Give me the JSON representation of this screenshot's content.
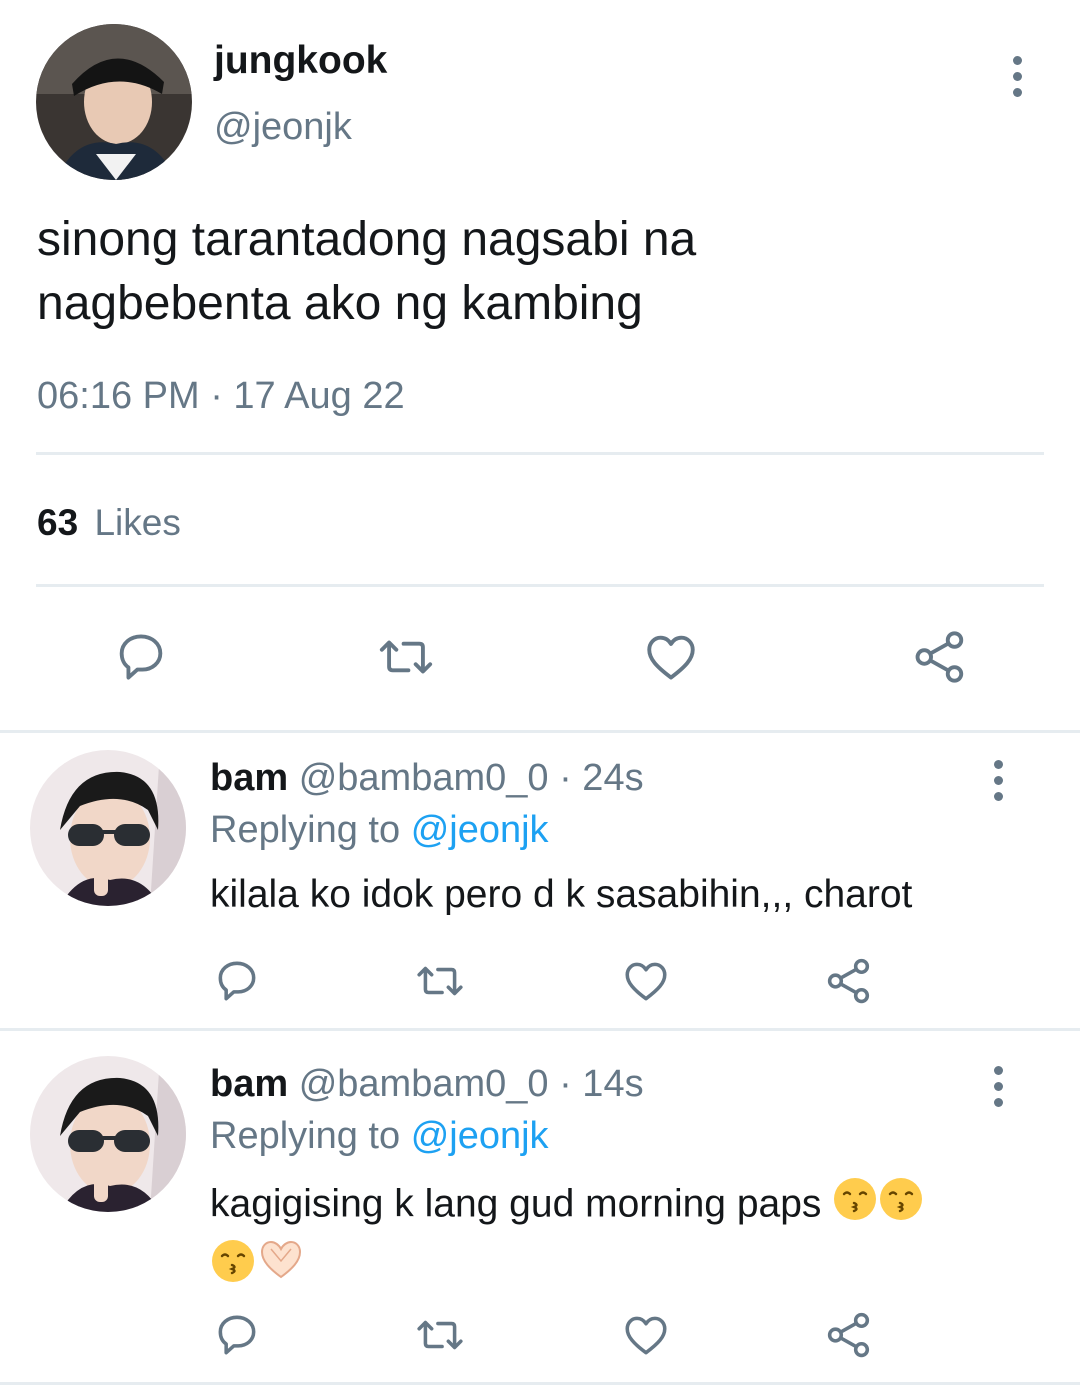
{
  "main_tweet": {
    "display_name": "jungkook",
    "handle": "@jeonjk",
    "text_line1": "sinong tarantadong nagsabi na",
    "text_line2": "nagbebenta ako ng kambing",
    "timestamp": "06:16 PM · 17 Aug 22",
    "likes_count": "63",
    "likes_label": "Likes",
    "actions": [
      "reply-icon",
      "retweet-icon",
      "like-icon",
      "share-icon"
    ]
  },
  "replies": [
    {
      "display_name": "bam",
      "handle": "@bambam0_0",
      "time": "· 24s",
      "replying_prefix": "Replying to",
      "replying_handle": "@jeonjk",
      "text": "kilala ko idok pero d k sasabihin,,, charot"
    },
    {
      "display_name": "bam",
      "handle": "@bambam0_0",
      "time": "· 14s",
      "replying_prefix": "Replying to",
      "replying_handle": "@jeonjk",
      "text": "kagigising k lang gud morning paps",
      "emojis": [
        "kissing-face",
        "kissing-face",
        "kissing-face",
        "heart-hands"
      ]
    }
  ],
  "colors": {
    "text": "#14171a",
    "muted": "#657786",
    "accent": "#1da1f2",
    "divider": "#e6ecf0"
  }
}
